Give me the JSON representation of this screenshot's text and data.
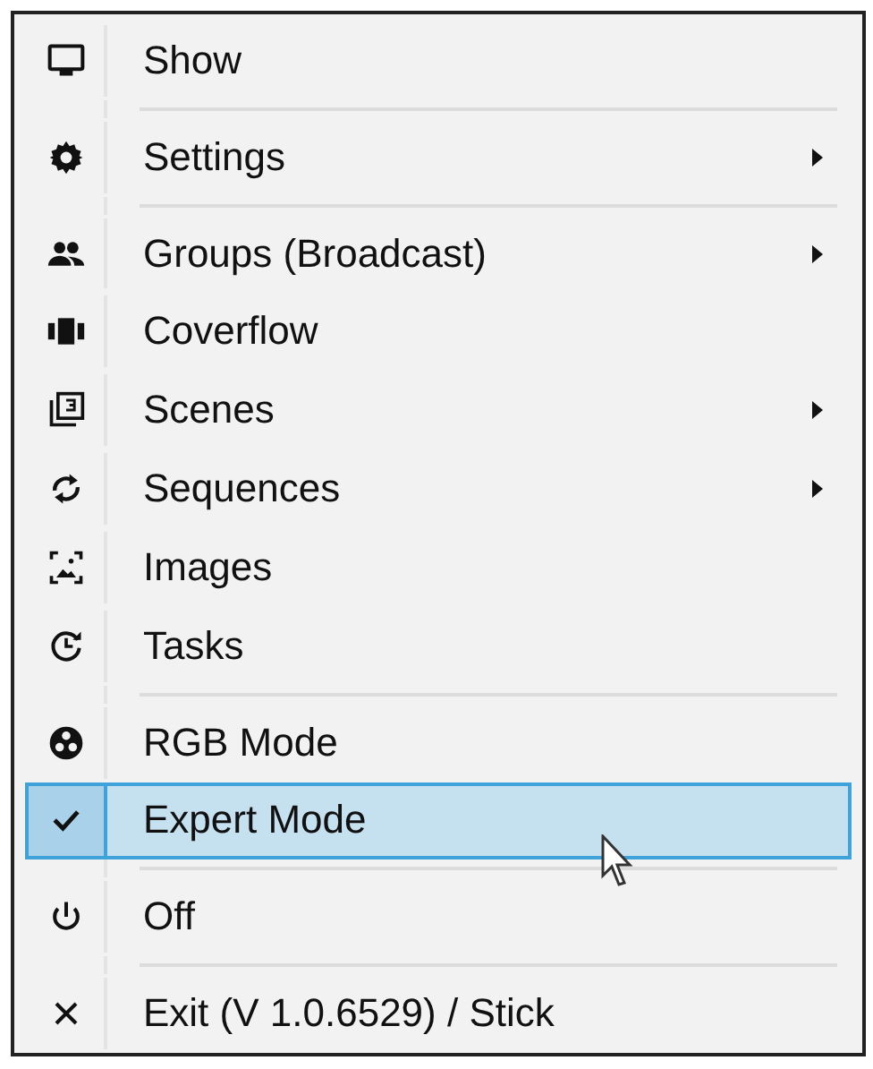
{
  "menu": {
    "items": [
      {
        "kind": "item",
        "label": "Show",
        "submenu": false,
        "checked": false,
        "selected": false
      },
      {
        "kind": "separator"
      },
      {
        "kind": "item",
        "label": "Settings",
        "submenu": true,
        "checked": false,
        "selected": false
      },
      {
        "kind": "separator"
      },
      {
        "kind": "item",
        "label": "Groups (Broadcast)",
        "submenu": true,
        "checked": false,
        "selected": false
      },
      {
        "kind": "item",
        "label": "Coverflow",
        "submenu": false,
        "checked": false,
        "selected": false
      },
      {
        "kind": "item",
        "label": "Scenes",
        "submenu": true,
        "checked": false,
        "selected": false
      },
      {
        "kind": "item",
        "label": "Sequences",
        "submenu": true,
        "checked": false,
        "selected": false
      },
      {
        "kind": "item",
        "label": "Images",
        "submenu": false,
        "checked": false,
        "selected": false
      },
      {
        "kind": "item",
        "label": "Tasks",
        "submenu": false,
        "checked": false,
        "selected": false
      },
      {
        "kind": "separator"
      },
      {
        "kind": "item",
        "label": "RGB Mode",
        "submenu": false,
        "checked": false,
        "selected": false
      },
      {
        "kind": "item",
        "label": "Expert Mode",
        "submenu": false,
        "checked": true,
        "selected": true
      },
      {
        "kind": "separator"
      },
      {
        "kind": "item",
        "label": "Off",
        "submenu": false,
        "checked": false,
        "selected": false
      },
      {
        "kind": "separator"
      },
      {
        "kind": "item",
        "label": "Exit (V 1.0.6529) / Stick",
        "submenu": false,
        "checked": false,
        "selected": false
      }
    ]
  }
}
